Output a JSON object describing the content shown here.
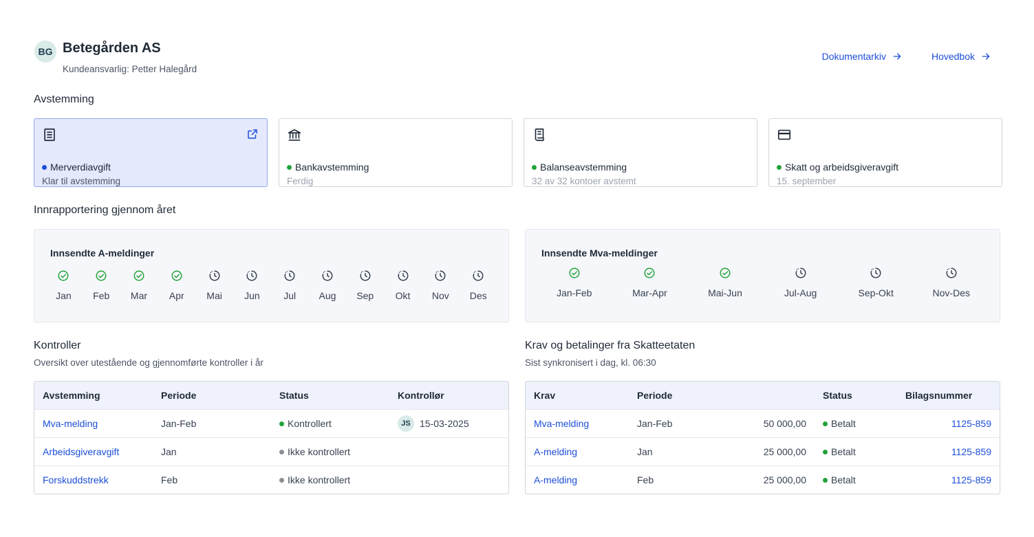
{
  "header": {
    "initials": "BG",
    "company": "Betegården AS",
    "manager": "Kundeansvarlig: Petter Halegård",
    "links": [
      {
        "label": "Dokumentarkiv"
      },
      {
        "label": "Hovedbok"
      }
    ]
  },
  "reconciliation": {
    "title": "Avstemming",
    "cards": [
      {
        "title": "Merverdiavgift",
        "sub": "Klar til avstemming",
        "status_color": "#1d4ed8",
        "icon": "receipt-icon",
        "active": true
      },
      {
        "title": "Bankavstemming",
        "sub": "Ferdig",
        "status_color": "#22a33a",
        "icon": "bank-icon"
      },
      {
        "title": "Balanseavstemming",
        "sub": "32 av 32 kontoer avstemt",
        "status_color": "#22a33a",
        "icon": "document-icon"
      },
      {
        "title": "Skatt og arbeidsgiveravgift",
        "sub": "15. september",
        "status_color": "#22a33a",
        "icon": "credit-card-icon"
      }
    ]
  },
  "reporting": {
    "title": "Innrapportering gjennom året",
    "a_messages": {
      "title": "Innsendte A-meldinger",
      "months": [
        {
          "label": "Jan",
          "status": "done"
        },
        {
          "label": "Feb",
          "status": "done"
        },
        {
          "label": "Mar",
          "status": "done"
        },
        {
          "label": "Apr",
          "status": "done"
        },
        {
          "label": "Mai",
          "status": "pending"
        },
        {
          "label": "Jun",
          "status": "pending"
        },
        {
          "label": "Jul",
          "status": "pending"
        },
        {
          "label": "Aug",
          "status": "pending"
        },
        {
          "label": "Sep",
          "status": "pending"
        },
        {
          "label": "Okt",
          "status": "pending"
        },
        {
          "label": "Nov",
          "status": "pending"
        },
        {
          "label": "Des",
          "status": "pending"
        }
      ]
    },
    "vat_messages": {
      "title": "Innsendte Mva-meldinger",
      "periods": [
        {
          "label": "Jan-Feb",
          "status": "done"
        },
        {
          "label": "Mar-Apr",
          "status": "done"
        },
        {
          "label": "Mai-Jun",
          "status": "done"
        },
        {
          "label": "Jul-Aug",
          "status": "pending"
        },
        {
          "label": "Sep-Okt",
          "status": "pending"
        },
        {
          "label": "Nov-Des",
          "status": "pending"
        }
      ]
    }
  },
  "controls": {
    "title": "Kontroller",
    "subtitle": "Oversikt over utestående og gjennomførte kontroller i år",
    "columns": [
      "Avstemming",
      "Periode",
      "Status",
      "Kontrollør"
    ],
    "rows": [
      {
        "name": "Mva-melding",
        "period": "Jan-Feb",
        "status": "Kontrollert",
        "status_color": "#22a33a",
        "controller_initials": "JS",
        "date": "15-03-2025"
      },
      {
        "name": "Arbeidsgiveravgift",
        "period": "Jan",
        "status": "Ikke kontrollert",
        "status_color": "#8b8f96",
        "controller_initials": "",
        "date": ""
      },
      {
        "name": "Forskuddstrekk",
        "period": "Feb",
        "status": "Ikke kontrollert",
        "status_color": "#8b8f96",
        "controller_initials": "",
        "date": ""
      }
    ]
  },
  "claims": {
    "title": "Krav og betalinger fra Skatteetaten",
    "subtitle": "Sist synkronisert i dag, kl. 06:30",
    "columns": [
      "Krav",
      "Periode",
      "Status",
      "Bilagsnummer"
    ],
    "rows": [
      {
        "name": "Mva-melding",
        "period": "Jan-Feb",
        "amount": "50 000,00",
        "status": "Betalt",
        "status_color": "#22a33a",
        "voucher": "1125-859"
      },
      {
        "name": "A-melding",
        "period": "Jan",
        "amount": "25 000,00",
        "status": "Betalt",
        "status_color": "#22a33a",
        "voucher": "1125-859"
      },
      {
        "name": "A-melding",
        "period": "Feb",
        "amount": "25 000,00",
        "status": "Betalt",
        "status_color": "#22a33a",
        "voucher": "1125-859"
      }
    ]
  },
  "colors": {
    "accent": "#1d4ed8",
    "success": "#22a33a",
    "neutral": "#8b8f96"
  }
}
